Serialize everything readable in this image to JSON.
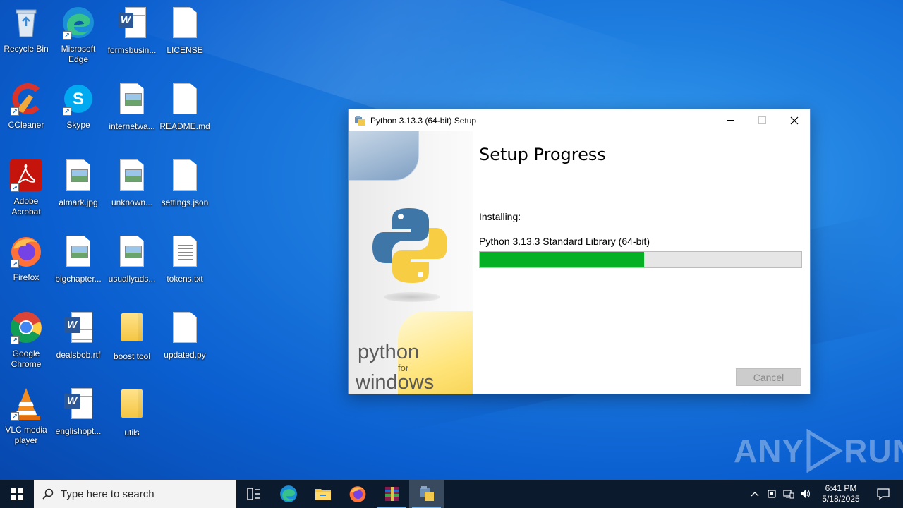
{
  "desktop": {
    "icons": [
      {
        "label": "Recycle Bin",
        "icon": "recycle-bin-icon"
      },
      {
        "label": "Microsoft Edge",
        "icon": "edge-icon"
      },
      {
        "label": "formsbusin...",
        "icon": "word-document-icon"
      },
      {
        "label": "LICENSE",
        "icon": "blank-file-icon"
      },
      {
        "label": "CCleaner",
        "icon": "ccleaner-icon"
      },
      {
        "label": "Skype",
        "icon": "skype-icon"
      },
      {
        "label": "internetwa...",
        "icon": "image-file-icon"
      },
      {
        "label": "README.md",
        "icon": "blank-file-icon"
      },
      {
        "label": "Adobe Acrobat",
        "icon": "acrobat-icon"
      },
      {
        "label": "almark.jpg",
        "icon": "image-file-icon"
      },
      {
        "label": "unknown...",
        "icon": "image-file-icon"
      },
      {
        "label": "settings.json",
        "icon": "blank-file-icon"
      },
      {
        "label": "Firefox",
        "icon": "firefox-icon"
      },
      {
        "label": "bigchapter...",
        "icon": "image-file-icon"
      },
      {
        "label": "usuallyads...",
        "icon": "image-file-icon"
      },
      {
        "label": "tokens.txt",
        "icon": "text-file-icon"
      },
      {
        "label": "Google Chrome",
        "icon": "chrome-icon"
      },
      {
        "label": "dealsbob.rtf",
        "icon": "word-document-icon"
      },
      {
        "label": "boost tool",
        "icon": "folder-icon"
      },
      {
        "label": "updated.py",
        "icon": "blank-file-icon"
      },
      {
        "label": "VLC media player",
        "icon": "vlc-icon"
      },
      {
        "label": "englishopt...",
        "icon": "word-document-icon"
      },
      {
        "label": "utils",
        "icon": "folder-icon"
      }
    ]
  },
  "setup_window": {
    "title": "Python 3.13.3 (64-bit) Setup",
    "heading": "Setup Progress",
    "installing_label": "Installing:",
    "current_item": "Python 3.13.3 Standard Library (64-bit)",
    "progress_fraction": 0.51,
    "cancel_label": "Cancel",
    "side_brand": {
      "line1": "python",
      "line2": "for",
      "line3": "windows"
    },
    "colors": {
      "progress": "#06b025"
    }
  },
  "watermark": {
    "text_left": "ANY",
    "text_right": "RUN"
  },
  "taskbar": {
    "search_placeholder": "Type here to search",
    "apps": [
      "task-view-icon",
      "edge-icon",
      "file-explorer-icon",
      "firefox-icon",
      "winrar-icon",
      "python-setup-icon"
    ],
    "clock_time": "6:41 PM",
    "clock_date": "5/18/2025"
  }
}
